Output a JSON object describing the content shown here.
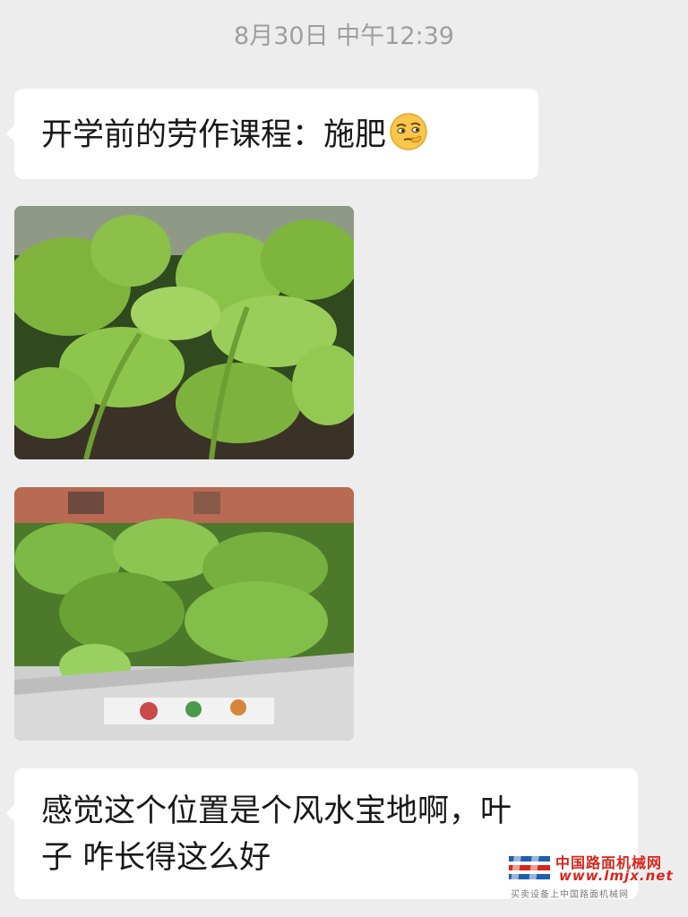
{
  "chat": {
    "timestamp": "8月30日 中午12:39",
    "messages": [
      {
        "type": "text",
        "text": "开学前的劳作课程：施肥",
        "emoji": "thinking-face-icon"
      },
      {
        "type": "image",
        "subject": "close-up-green-seedlings"
      },
      {
        "type": "image",
        "subject": "seedlings-in-planter-box"
      },
      {
        "type": "text",
        "line1": "感觉这个位置是个风水宝地啊，叶",
        "line2": "子 咋长得这么好"
      }
    ]
  },
  "watermark": {
    "title": "中国路面机械网",
    "url": "www.lmjx.net",
    "slogan": "买卖设备上中国路面机械网"
  },
  "colors": {
    "background": "#ededed",
    "bubble": "#ffffff",
    "timestamp": "#9e9e9e",
    "watermark_red": "#d9261c"
  }
}
